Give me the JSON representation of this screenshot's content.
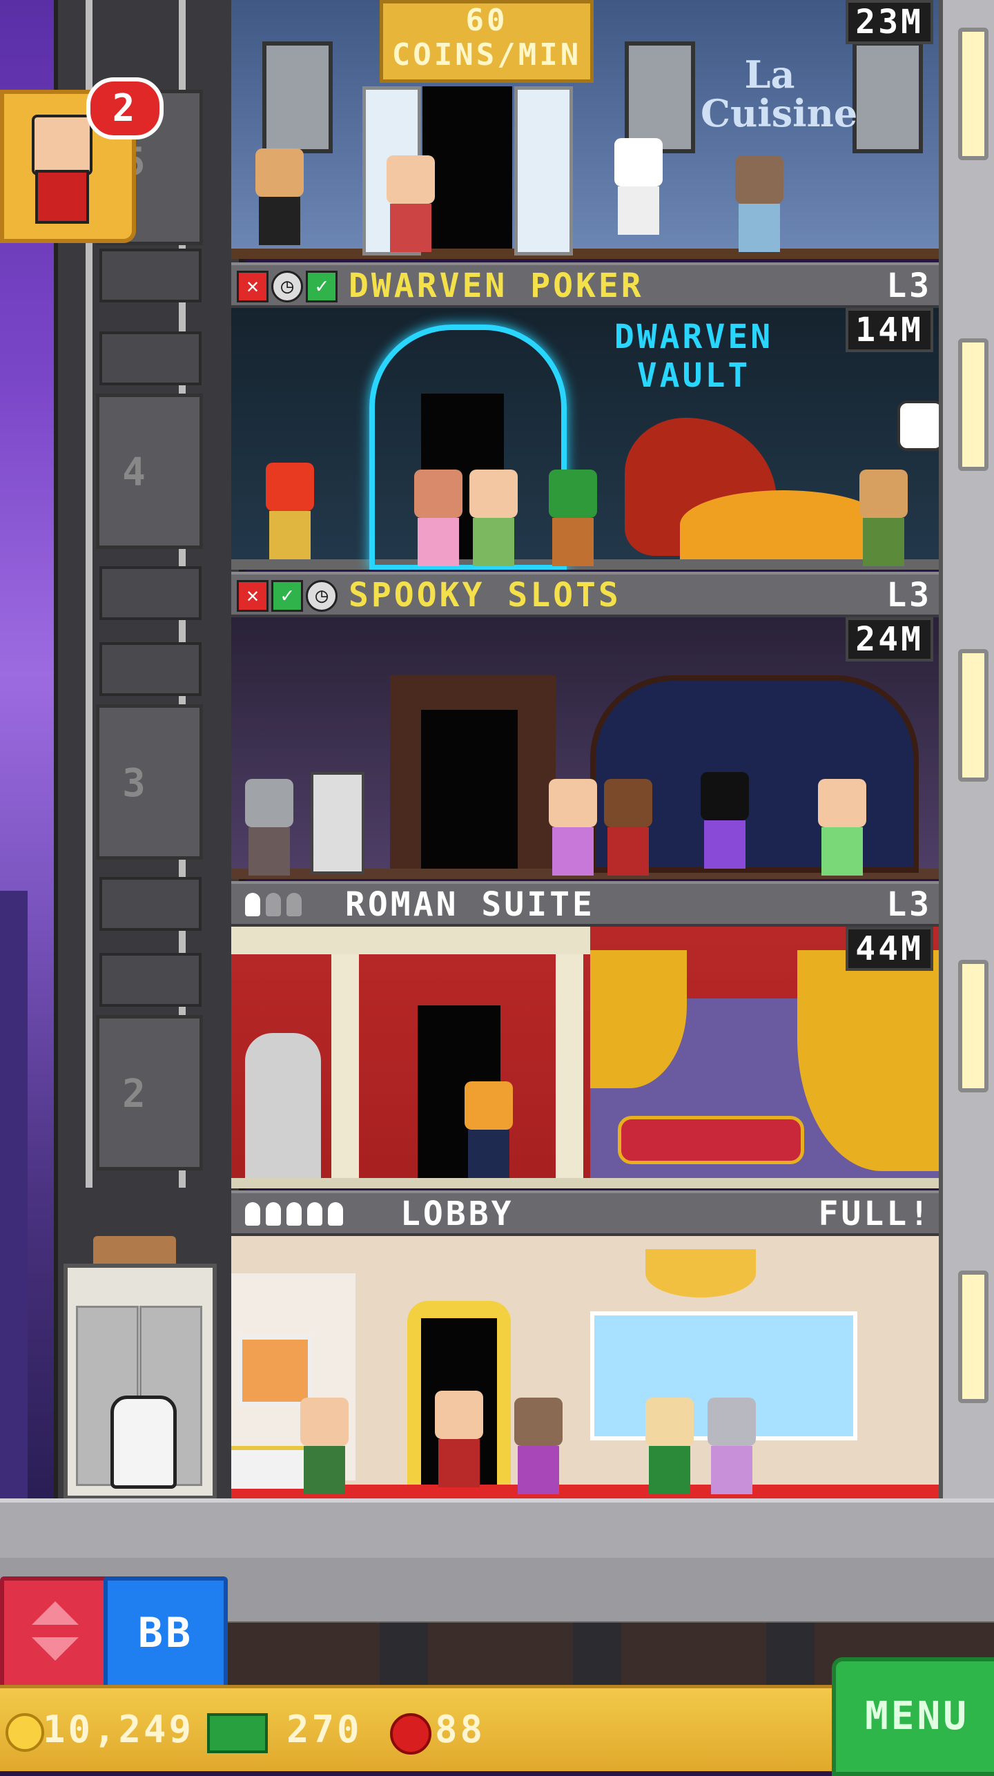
{
  "top_floor": {
    "sign_top": "60",
    "sign_bottom": "COINS/MIN",
    "stock": "23M",
    "restaurant_sign_line1": "La",
    "restaurant_sign_line2": "Cuisine"
  },
  "floors": [
    {
      "name": "DWARVEN POKER",
      "level": "L3",
      "stock": "14M",
      "wall_sign_line1": "DWARVEN",
      "wall_sign_line2": "VAULT",
      "status_icons": [
        "x",
        "clock",
        "check"
      ]
    },
    {
      "name": "SPOOKY SLOTS",
      "level": "L3",
      "stock": "24M",
      "status_icons": [
        "x",
        "check",
        "clock"
      ]
    },
    {
      "name": "ROMAN SUITE",
      "level": "L3",
      "stock": "44M",
      "residents_filled": 1,
      "residents_total": 3
    },
    {
      "name": "LOBBY",
      "level": "FULL!",
      "residents_filled": 5,
      "residents_total": 5
    }
  ],
  "elevator": {
    "floor_labels": [
      "5",
      "4",
      "3",
      "2"
    ]
  },
  "notification": {
    "count": "2"
  },
  "controls": {
    "bb_label": "BB",
    "menu_label": "MENU"
  },
  "currency": {
    "coins": "10,249",
    "bux": "270",
    "gems": "88"
  },
  "colors": {
    "floor_name": "#f4e04a",
    "lobby_name": "#ffffff",
    "menu_green": "#2fb64a",
    "bb_blue": "#1f7ff0",
    "arrows_red": "#e0334a"
  }
}
